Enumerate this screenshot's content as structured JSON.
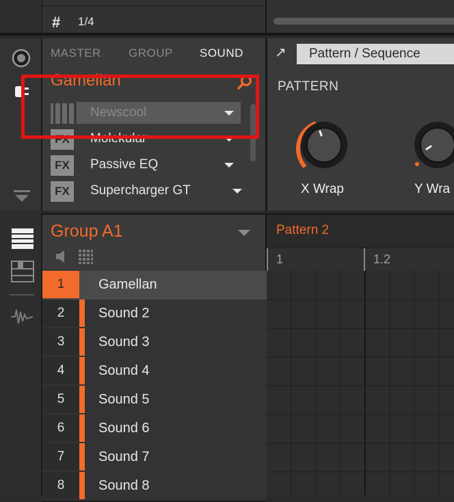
{
  "header": {
    "step_label": "1/4"
  },
  "sound_panel": {
    "tabs": [
      "MASTER",
      "GROUP",
      "SOUND"
    ],
    "active_tab": "SOUND",
    "title": "Gamellan",
    "plugins": [
      {
        "icon": "instrument",
        "label": "Newscool",
        "selected": true
      },
      {
        "icon": "FX",
        "label": "Molekular",
        "selected": false
      },
      {
        "icon": "FX",
        "label": "Passive EQ",
        "selected": false
      },
      {
        "icon": "FX",
        "label": "Supercharger GT",
        "selected": false
      }
    ]
  },
  "pattern_panel": {
    "button_label": "Pattern / Sequence",
    "heading": "PATTERN",
    "knobs": [
      {
        "label": "X Wrap"
      },
      {
        "label": "Y Wra"
      }
    ]
  },
  "group": {
    "title": "Group A1",
    "sounds": [
      {
        "num": "1",
        "name": "Gamellan",
        "selected": true
      },
      {
        "num": "2",
        "name": "Sound 2"
      },
      {
        "num": "3",
        "name": "Sound 3"
      },
      {
        "num": "4",
        "name": "Sound 4"
      },
      {
        "num": "5",
        "name": "Sound 5"
      },
      {
        "num": "6",
        "name": "Sound 6"
      },
      {
        "num": "7",
        "name": "Sound 7"
      },
      {
        "num": "8",
        "name": "Sound 8"
      }
    ]
  },
  "pattern_editor": {
    "pattern_name": "Pattern 2",
    "ruler": [
      "1",
      "1.2"
    ]
  },
  "colors": {
    "accent": "#f26b2a",
    "highlight": "#e01515"
  }
}
